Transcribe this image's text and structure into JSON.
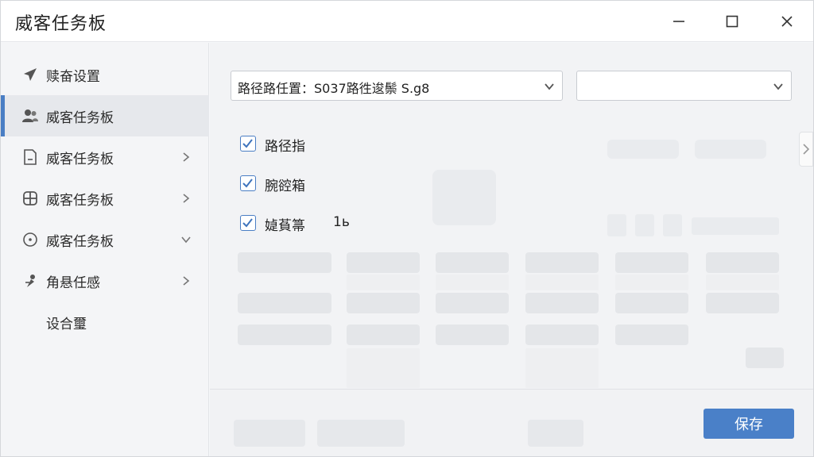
{
  "app": {
    "title": "威客任务板"
  },
  "sidebar": {
    "items": [
      {
        "label": "赎奋设置",
        "icon": "send-icon",
        "chevron": ""
      },
      {
        "label": "威客任务板",
        "icon": "users-icon",
        "chevron": ""
      },
      {
        "label": "威客任务板",
        "icon": "document-icon",
        "chevron": "right"
      },
      {
        "label": "威客任务板",
        "icon": "grid-icon",
        "chevron": "right"
      },
      {
        "label": "威客任务板",
        "icon": "circle-icon",
        "chevron": "down"
      },
      {
        "label": "角悬任感",
        "icon": "pin-icon",
        "chevron": "right"
      },
      {
        "label": "设合璽",
        "icon": "",
        "chevron": ""
      }
    ],
    "active_index": 1
  },
  "form": {
    "select_primary": "路径路任置：S037路徃逡鬃 S.g8",
    "select_secondary": "",
    "checkboxes": [
      {
        "label": "路径指",
        "checked": true,
        "extra": ""
      },
      {
        "label": "腕谾箱",
        "checked": true,
        "extra": ""
      },
      {
        "label": "媫萯箒",
        "checked": true,
        "extra": "1ь"
      }
    ]
  },
  "footer": {
    "save_label": "保存"
  },
  "colors": {
    "accent": "#4a80c8",
    "active_bar": "#4a7ec4"
  }
}
